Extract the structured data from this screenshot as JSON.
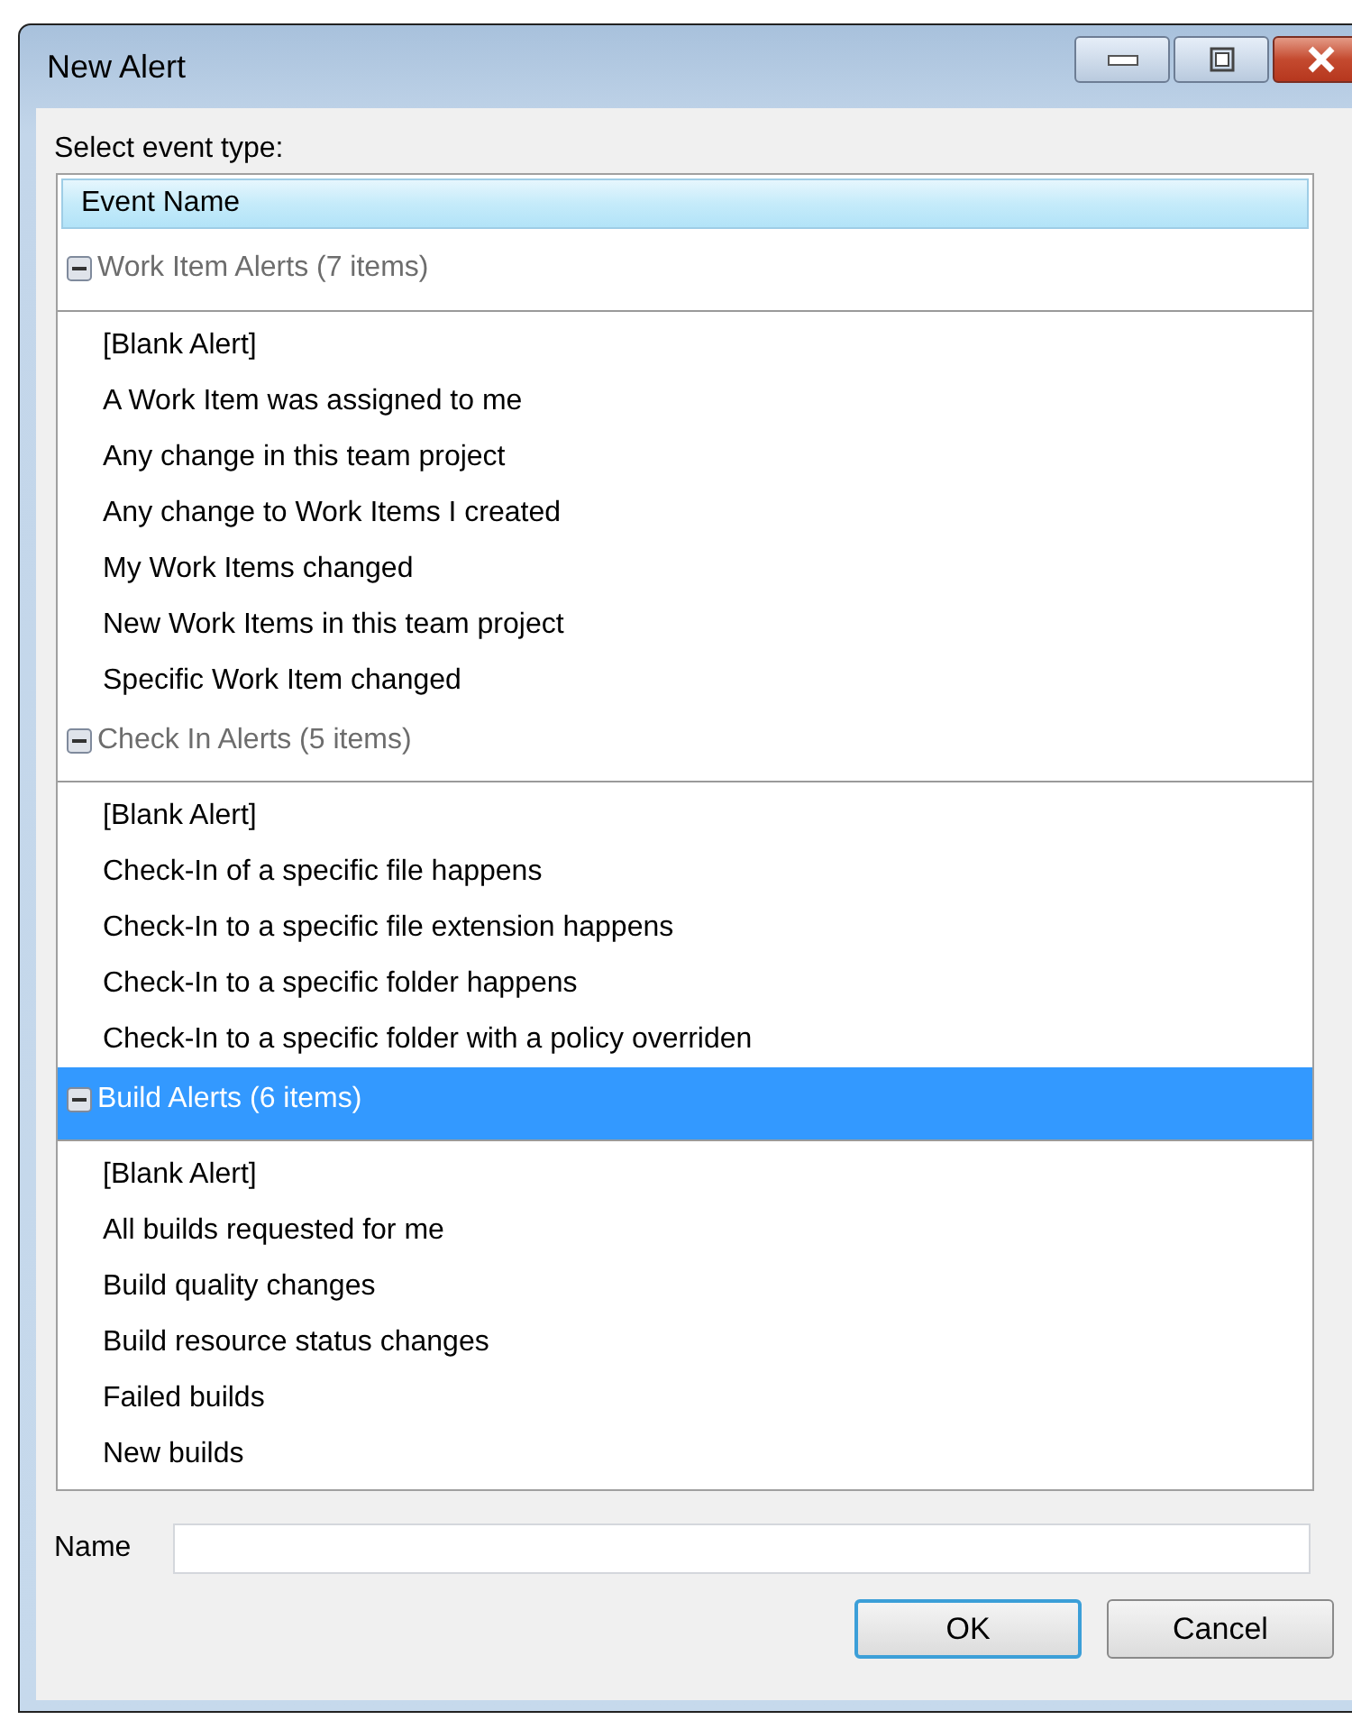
{
  "window": {
    "title": "New Alert"
  },
  "event_label": "Select event type:",
  "list": {
    "column": "Event Name",
    "groups": [
      {
        "title": "Work Item Alerts (7 items)",
        "expanded": true,
        "selected": false,
        "items": [
          "[Blank Alert]",
          "A Work Item was assigned to me",
          "Any change in this team project",
          "Any change to Work Items I created",
          "My Work Items changed",
          "New Work Items in this team project",
          "Specific Work Item changed"
        ]
      },
      {
        "title": "Check In Alerts (5 items)",
        "expanded": true,
        "selected": false,
        "items": [
          "[Blank Alert]",
          "Check-In of a specific file happens",
          "Check-In to a specific file extension happens",
          "Check-In to a specific folder happens",
          "Check-In to a specific folder with a policy overriden"
        ]
      },
      {
        "title": "Build Alerts (6 items)",
        "expanded": true,
        "selected": true,
        "items": [
          "[Blank Alert]",
          "All builds requested for me",
          "Build quality changes",
          "Build resource status changes",
          "Failed builds",
          "New builds"
        ]
      }
    ]
  },
  "name_label": "Name",
  "buttons": [
    {
      "label": "OK",
      "default": true
    },
    {
      "label": "Cancel",
      "default": false
    }
  ]
}
